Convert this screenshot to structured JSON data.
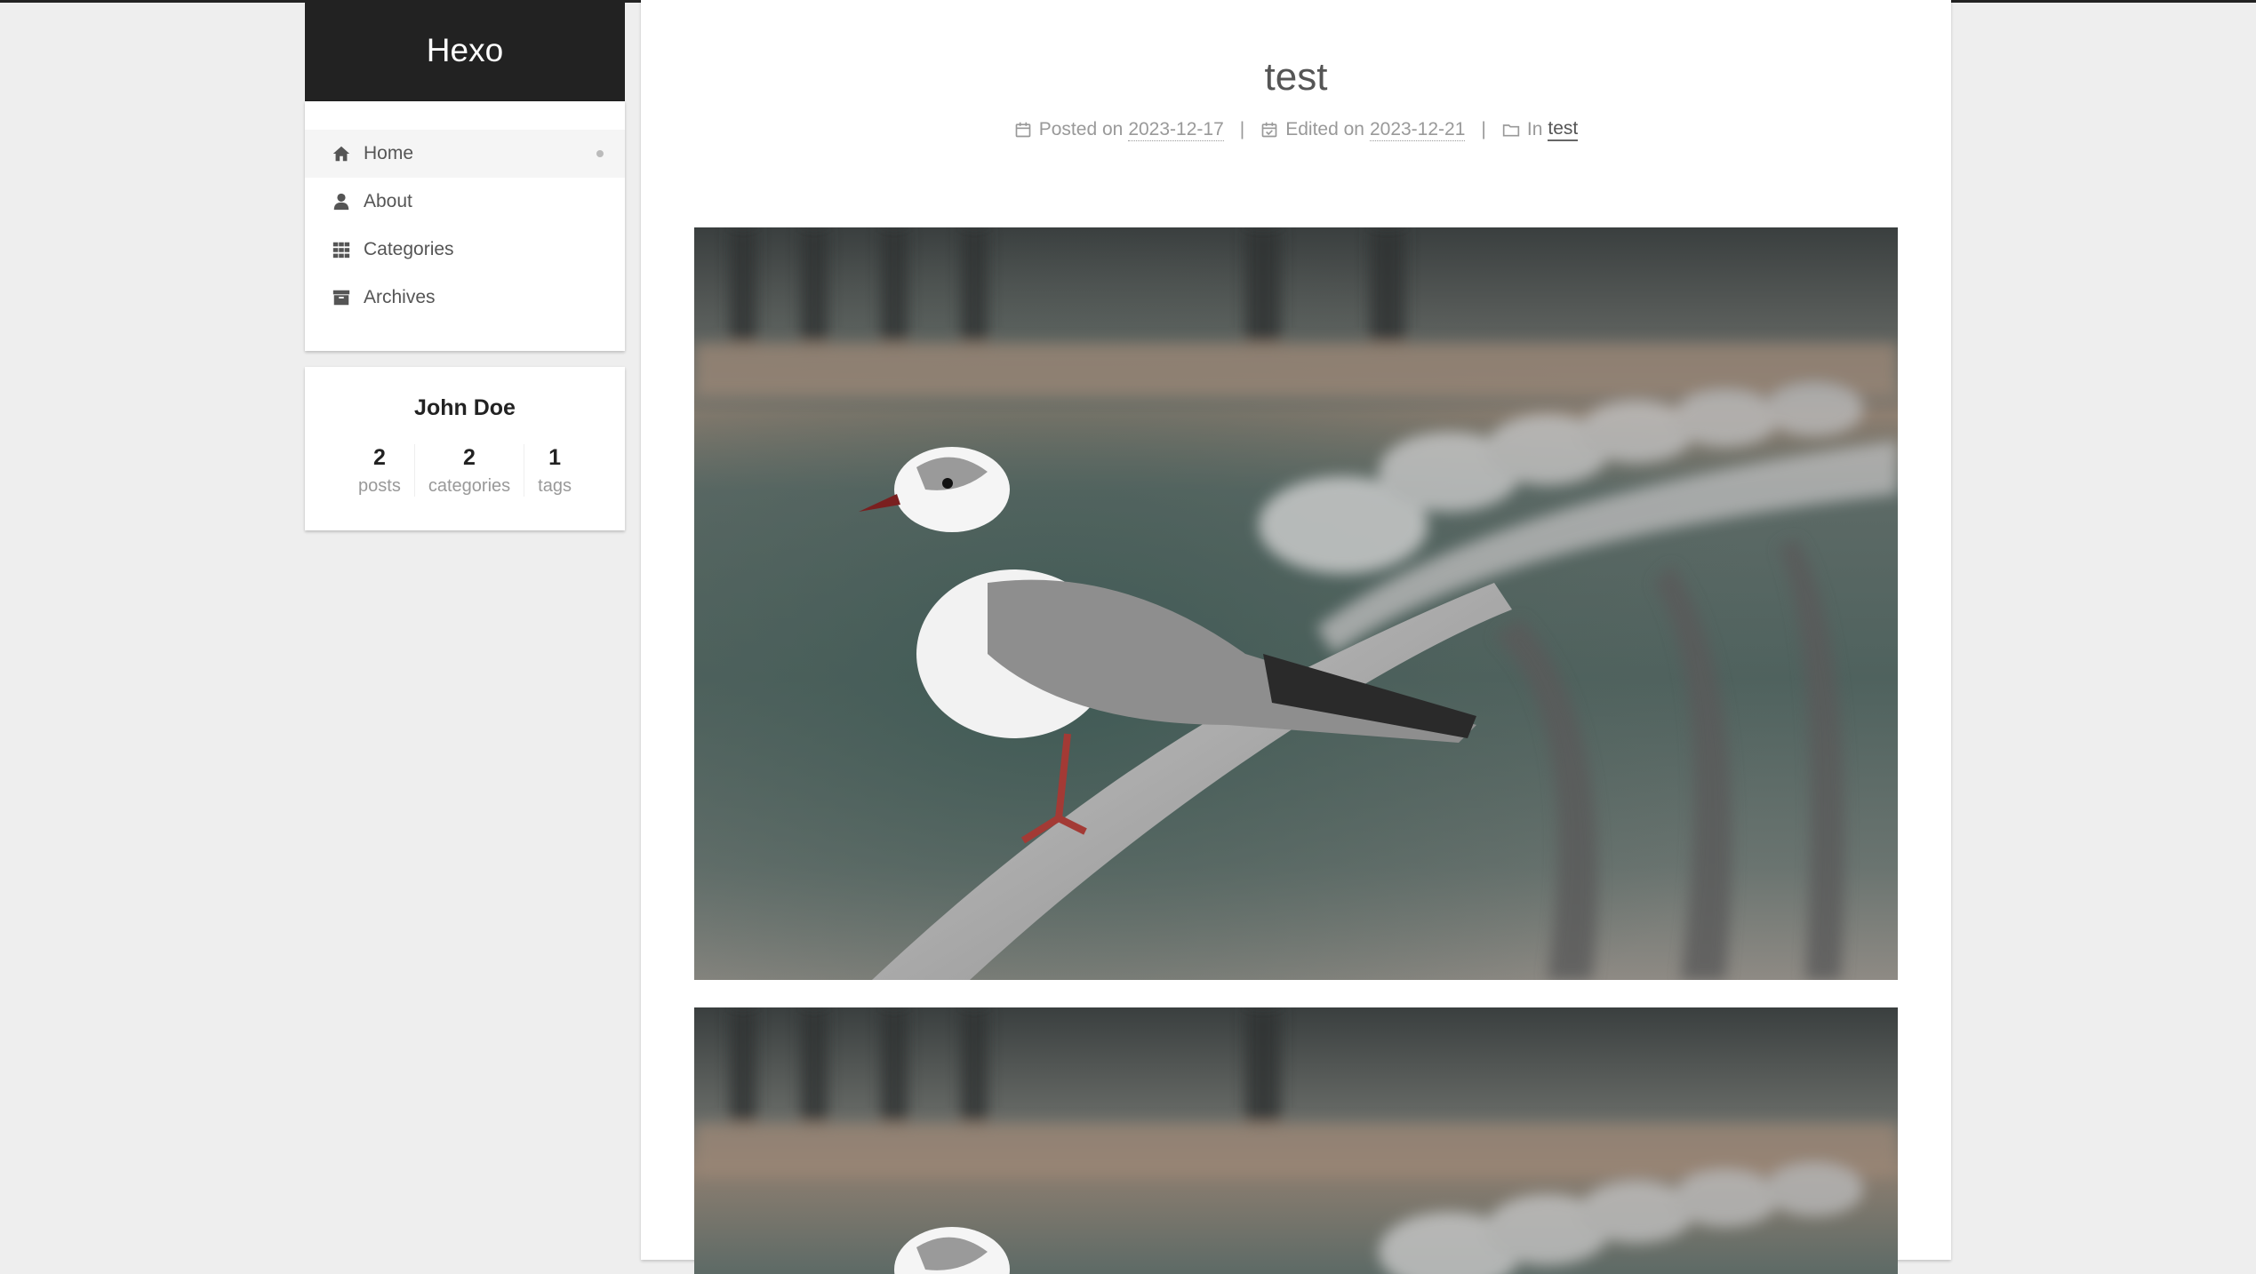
{
  "site": {
    "brand": "Hexo"
  },
  "menu": {
    "items": [
      {
        "label": "Home",
        "icon": "home-icon",
        "active": true
      },
      {
        "label": "About",
        "icon": "user-icon",
        "active": false
      },
      {
        "label": "Categories",
        "icon": "grid-icon",
        "active": false
      },
      {
        "label": "Archives",
        "icon": "archive-icon",
        "active": false
      }
    ]
  },
  "author": {
    "name": "John Doe",
    "stats": [
      {
        "count": "2",
        "label": "posts"
      },
      {
        "count": "2",
        "label": "categories"
      },
      {
        "count": "1",
        "label": "tags"
      }
    ]
  },
  "post": {
    "title": "test",
    "posted_label": "Posted on",
    "posted_date": "2023-12-17",
    "edited_label": "Edited on",
    "edited_date": "2023-12-21",
    "in_label": "In",
    "category": "test",
    "separator": "|"
  },
  "colors": {
    "brand_bg": "#222222",
    "page_bg": "#eeeeee",
    "card_bg": "#ffffff"
  }
}
